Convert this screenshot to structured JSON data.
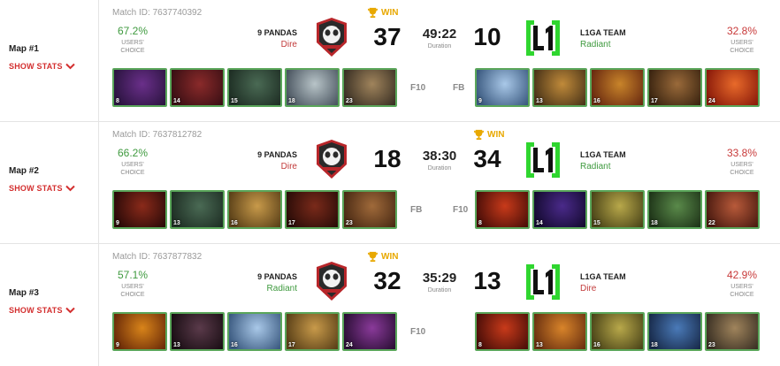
{
  "labels": {
    "show_stats": "SHOW STATS",
    "users_choice": "USERS' CHOICE",
    "duration": "Duration",
    "win": "WIN"
  },
  "maps": [
    {
      "title": "Map #1",
      "match_id": "Match ID: 7637740392",
      "left": {
        "pct": "67.2%",
        "name": "9 PANDAS",
        "side": "Dire",
        "side_class": "side-dire",
        "score": "37"
      },
      "right": {
        "pct": "32.8%",
        "name": "L1GA TEAM",
        "side": "Radiant",
        "side_class": "side-radiant",
        "score": "10"
      },
      "duration": "49:22",
      "winner": "left",
      "left_tag": "F10",
      "right_tag": "FB",
      "left_heroes": [
        {
          "num": "8",
          "c1": "#6a2f8a",
          "c2": "#2b1440"
        },
        {
          "num": "14",
          "c1": "#8a2a2a",
          "c2": "#3a0f14"
        },
        {
          "num": "15",
          "c1": "#4a6a54",
          "c2": "#1e2e24"
        },
        {
          "num": "18",
          "c1": "#b8c4c8",
          "c2": "#4a5560"
        },
        {
          "num": "23",
          "c1": "#a0845c",
          "c2": "#3a3024"
        }
      ],
      "right_heroes": [
        {
          "num": "9",
          "c1": "#a9c8e8",
          "c2": "#3b5a80"
        },
        {
          "num": "13",
          "c1": "#c08a3a",
          "c2": "#4a3418"
        },
        {
          "num": "16",
          "c1": "#c8842a",
          "c2": "#6a2a10"
        },
        {
          "num": "17",
          "c1": "#9a6a3a",
          "c2": "#3a2410"
        },
        {
          "num": "24",
          "c1": "#e86a2a",
          "c2": "#8a1a0a"
        }
      ]
    },
    {
      "title": "Map #2",
      "match_id": "Match ID: 7637812782",
      "left": {
        "pct": "66.2%",
        "name": "9 PANDAS",
        "side": "Dire",
        "side_class": "side-dire",
        "score": "18"
      },
      "right": {
        "pct": "33.8%",
        "name": "L1GA TEAM",
        "side": "Radiant",
        "side_class": "side-radiant",
        "score": "34"
      },
      "duration": "38:30",
      "winner": "right",
      "left_tag": "FB",
      "right_tag": "F10",
      "left_heroes": [
        {
          "num": "9",
          "c1": "#8a2a1a",
          "c2": "#2a0a08"
        },
        {
          "num": "13",
          "c1": "#4a6a54",
          "c2": "#1e2e24"
        },
        {
          "num": "16",
          "c1": "#c89a4a",
          "c2": "#5a4018"
        },
        {
          "num": "17",
          "c1": "#7a2a1a",
          "c2": "#2a0c08"
        },
        {
          "num": "23",
          "c1": "#a06a3a",
          "c2": "#4a2a14"
        }
      ],
      "right_heroes": [
        {
          "num": "8",
          "c1": "#c83a1a",
          "c2": "#4a0e08"
        },
        {
          "num": "14",
          "c1": "#4a2a8a",
          "c2": "#140a30"
        },
        {
          "num": "15",
          "c1": "#b8a84a",
          "c2": "#4a4418"
        },
        {
          "num": "18",
          "c1": "#5a8a4a",
          "c2": "#1e3418"
        },
        {
          "num": "22",
          "c1": "#b85a3a",
          "c2": "#4a1a10"
        }
      ]
    },
    {
      "title": "Map #3",
      "match_id": "Match ID: 7637877832",
      "left": {
        "pct": "57.1%",
        "name": "9 PANDAS",
        "side": "Radiant",
        "side_class": "side-radiant",
        "score": "32"
      },
      "right": {
        "pct": "42.9%",
        "name": "L1GA TEAM",
        "side": "Dire",
        "side_class": "side-dire",
        "score": "13"
      },
      "duration": "35:29",
      "winner": "left",
      "left_tag": "F10",
      "right_tag": "",
      "left_heroes": [
        {
          "num": "9",
          "c1": "#d8841a",
          "c2": "#6a2a08"
        },
        {
          "num": "13",
          "c1": "#5a3a4a",
          "c2": "#1a0e14"
        },
        {
          "num": "16",
          "c1": "#a9c8e8",
          "c2": "#3b5a80"
        },
        {
          "num": "17",
          "c1": "#c89a4a",
          "c2": "#5a4018"
        },
        {
          "num": "24",
          "c1": "#8a3a9a",
          "c2": "#2a0e34"
        }
      ],
      "right_heroes": [
        {
          "num": "8",
          "c1": "#c83a1a",
          "c2": "#4a0e08"
        },
        {
          "num": "13",
          "c1": "#d8842a",
          "c2": "#6a3010"
        },
        {
          "num": "16",
          "c1": "#b8a84a",
          "c2": "#4a4418"
        },
        {
          "num": "18",
          "c1": "#4a7ab8",
          "c2": "#182a4a"
        },
        {
          "num": "23",
          "c1": "#a0845c",
          "c2": "#3a3024"
        }
      ]
    }
  ]
}
